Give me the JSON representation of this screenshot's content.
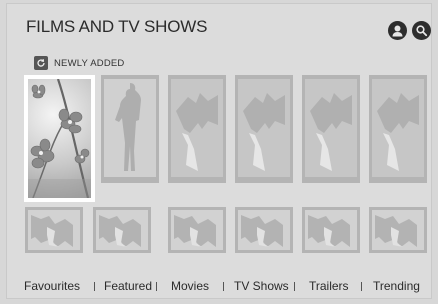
{
  "header": {
    "title": "FILMS AND TV SHOWS",
    "profile_icon": "user-icon",
    "search_icon": "search-icon"
  },
  "section": {
    "icon": "refresh-icon",
    "label": "NEWLY ADDED"
  },
  "nav": {
    "items": [
      "Favourites",
      "Featured",
      "Movies",
      "TV Shows",
      "Trailers",
      "Trending"
    ]
  },
  "colors": {
    "background": "#dcdcdc",
    "tile": "#b4b4b4",
    "placeholder_art": "#d9d9d9",
    "focus_border": "#ffffff",
    "icon_dark": "#2d2d2d"
  }
}
